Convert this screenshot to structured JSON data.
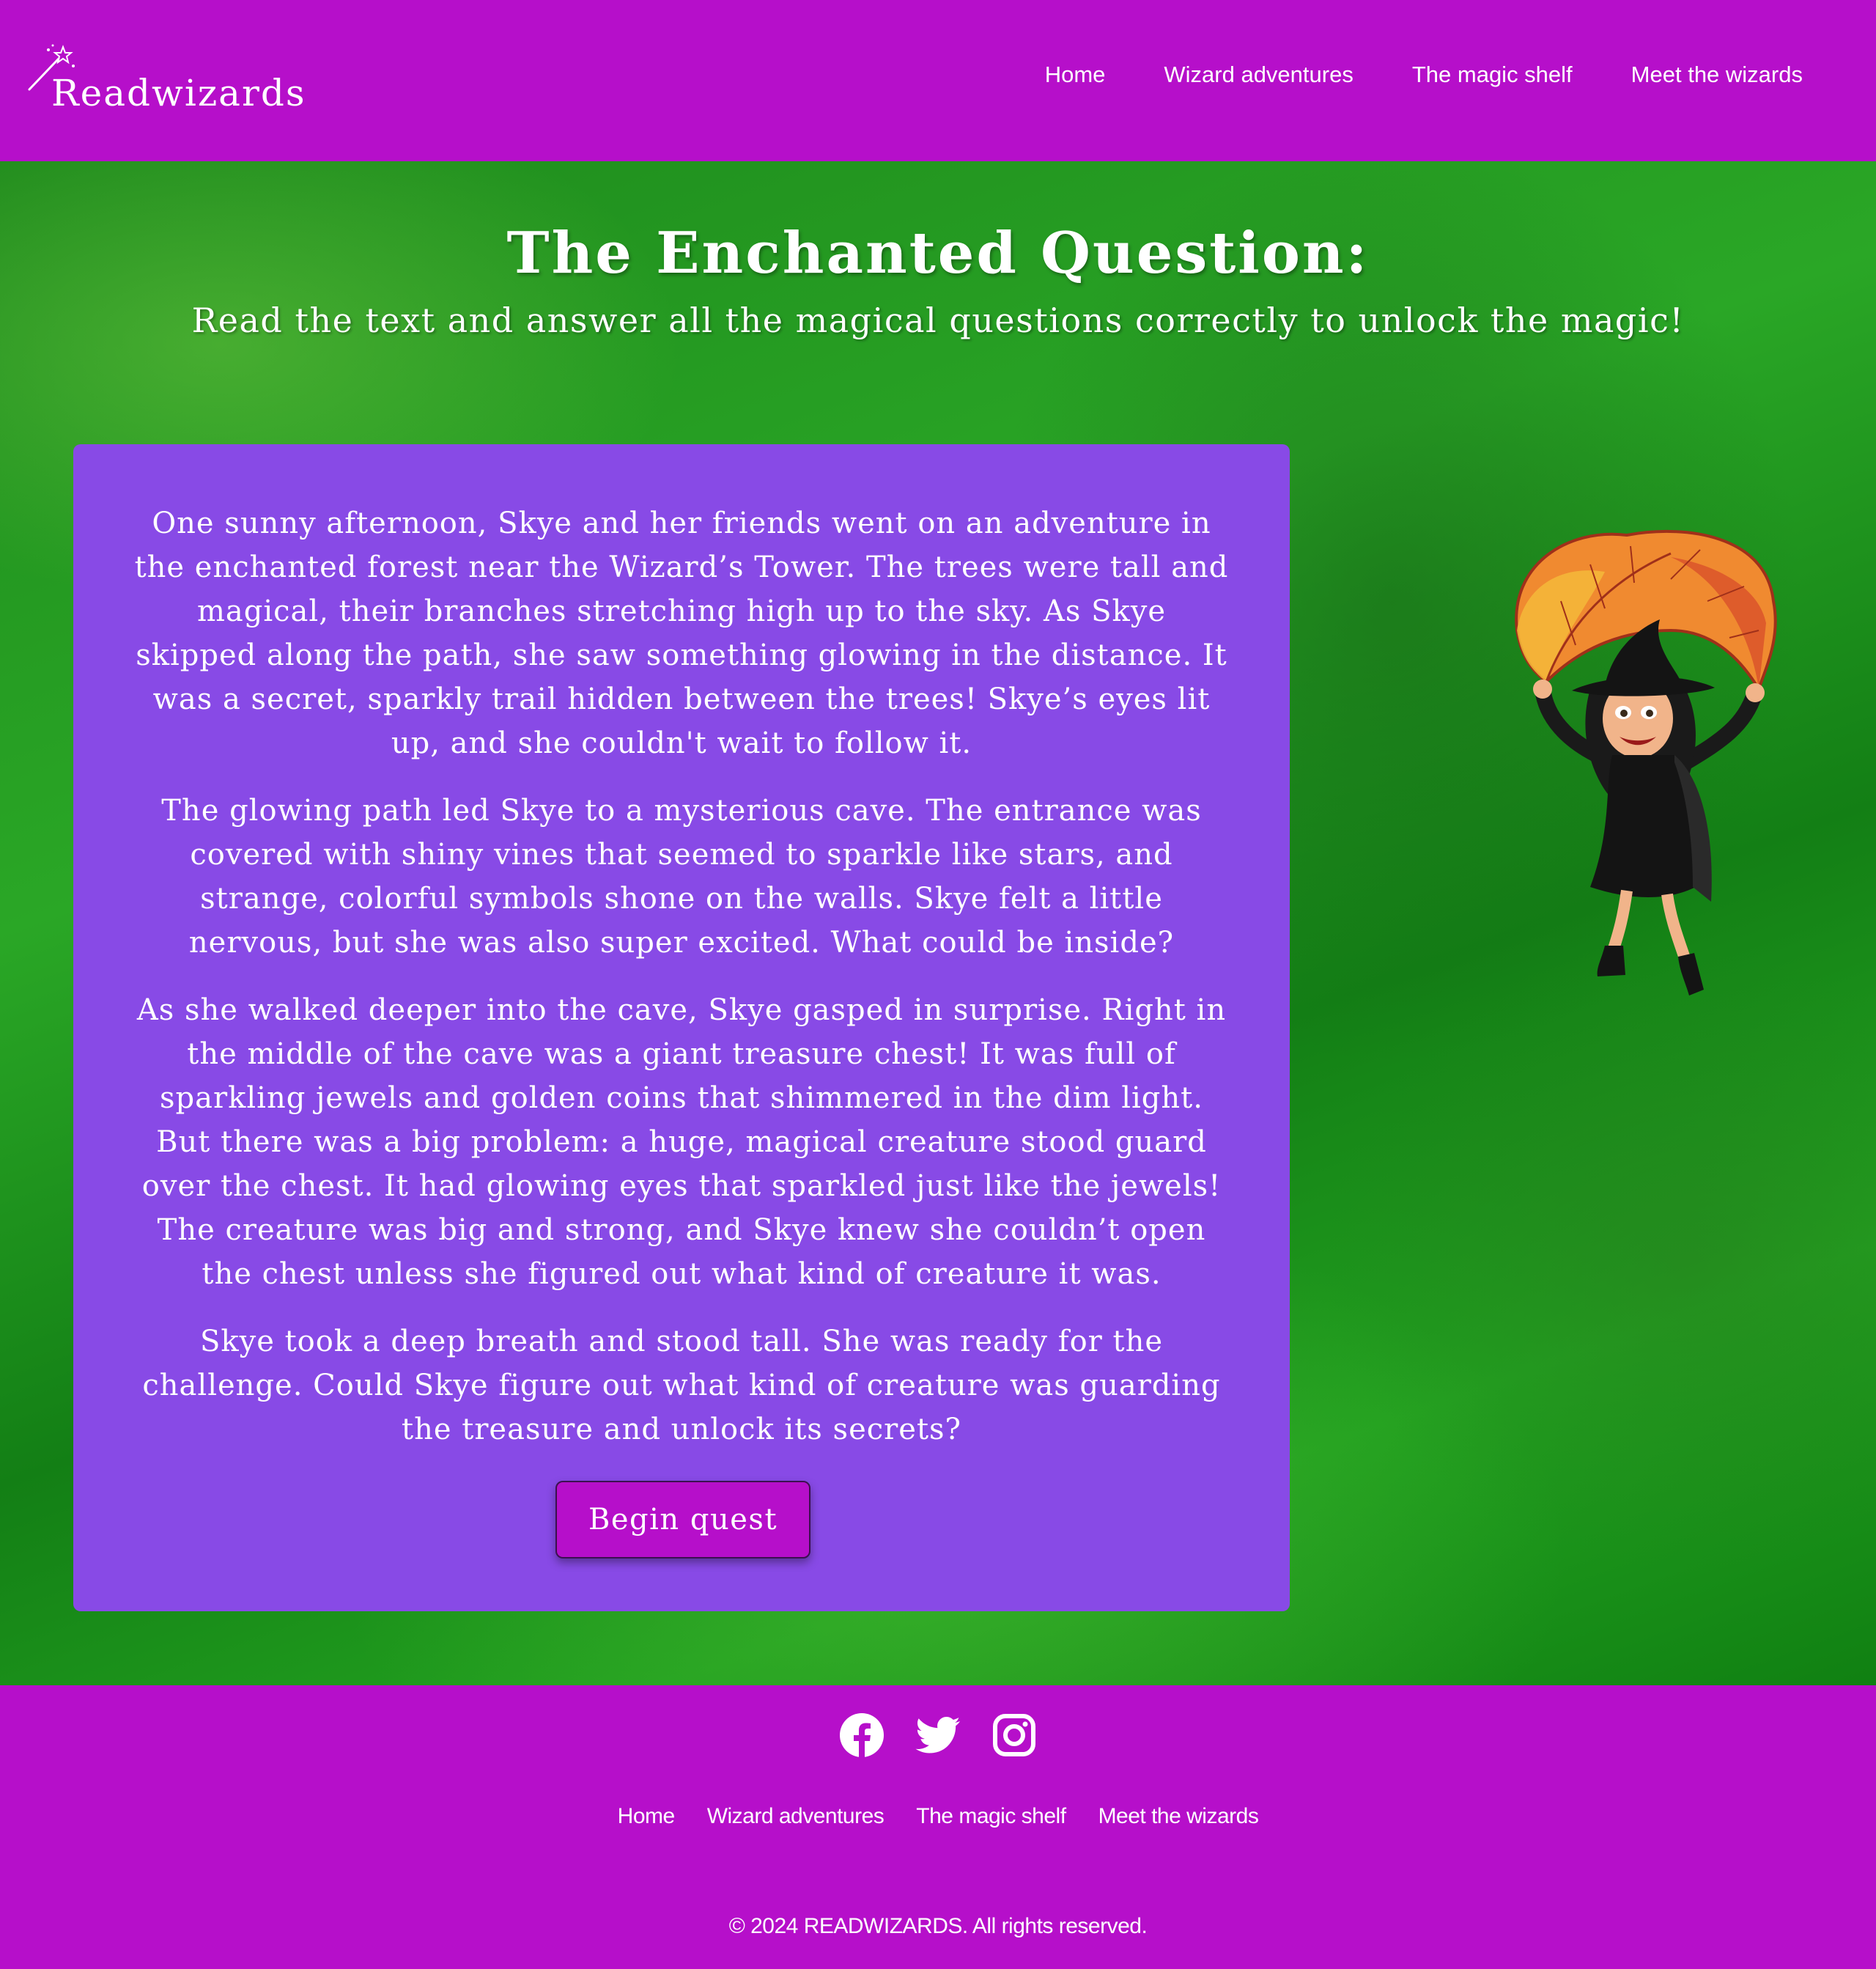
{
  "header": {
    "logo_text": "Readwizards",
    "nav": [
      "Home",
      "Wizard adventures",
      "The magic shelf",
      "Meet the wizards"
    ]
  },
  "main": {
    "title": "The Enchanted Question:",
    "subtitle": "Read the text and answer all the magical questions correctly to unlock the magic!",
    "story": [
      "One sunny afternoon, Skye and her friends went on an adventure in the enchanted forest near the Wizard’s Tower. The trees were tall and magical, their branches stretching high up to the sky. As Skye skipped along the path, she saw something glowing in the distance. It was a secret, sparkly trail hidden between the trees! Skye’s eyes lit up, and she couldn't wait to follow it.",
      "The glowing path led Skye to a mysterious cave. The entrance was covered with shiny vines that seemed to sparkle like stars, and strange, colorful symbols shone on the walls. Skye felt a little nervous, but she was also super excited. What could be inside?",
      "As she walked deeper into the cave, Skye gasped in surprise. Right in the middle of the cave was a giant treasure chest! It was full of sparkling jewels and golden coins that shimmered in the dim light. But there was a big problem: a huge, magical creature stood guard over the chest. It had glowing eyes that sparkled just like the jewels! The creature was big and strong, and Skye knew she couldn’t open the chest unless she figured out what kind of creature it was.",
      "Skye took a deep breath and stood tall. She was ready for the challenge. Could Skye figure out what kind of creature was guarding the treasure and unlock its secrets?"
    ],
    "button_label": "Begin quest"
  },
  "footer": {
    "social_icons": [
      "facebook-icon",
      "twitter-icon",
      "instagram-icon"
    ],
    "nav": [
      "Home",
      "Wizard adventures",
      "The magic shelf",
      "Meet the wizards"
    ],
    "copyright": "© 2024 READWIZARDS. All rights reserved."
  },
  "colors": {
    "brand_purple": "#b60fca",
    "card_purple": "#884ae6",
    "background_green": "#22a01f"
  }
}
